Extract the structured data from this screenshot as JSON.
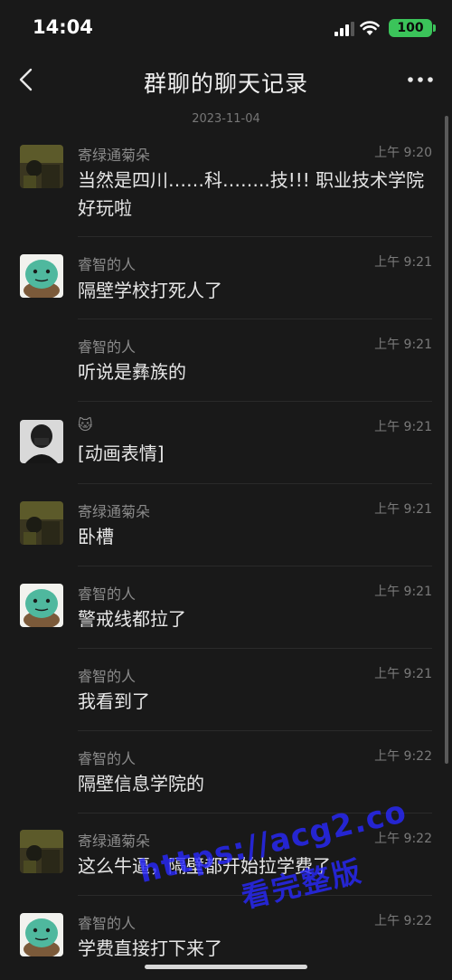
{
  "status_bar": {
    "time": "14:04",
    "battery": "100"
  },
  "nav": {
    "title": "群聊的聊天记录",
    "back_icon": "chevron-left-icon",
    "more_icon": "more-dots-icon"
  },
  "date_separator": "2023-11-04",
  "messages": [
    {
      "sender": "寄绿通菊朵",
      "time": "上午 9:20",
      "text": "当然是四川……科……..技!!! 职业技术学院好玩啦",
      "avatar": "avatar-dark-photo"
    },
    {
      "sender": "睿智的人",
      "time": "上午 9:21",
      "text": "隔壁学校打死人了",
      "avatar": "avatar-green-turtle"
    },
    {
      "sender": "睿智的人",
      "time": "上午 9:21",
      "text": "听说是彝族的",
      "avatar": ""
    },
    {
      "sender": "🐱",
      "time": "上午 9:21",
      "text": "[动画表情]",
      "avatar": "avatar-masked-person"
    },
    {
      "sender": "寄绿通菊朵",
      "time": "上午 9:21",
      "text": "卧槽",
      "avatar": "avatar-dark-photo"
    },
    {
      "sender": "睿智的人",
      "time": "上午 9:21",
      "text": "警戒线都拉了",
      "avatar": "avatar-green-turtle"
    },
    {
      "sender": "睿智的人",
      "time": "上午 9:21",
      "text": "我看到了",
      "avatar": ""
    },
    {
      "sender": "睿智的人",
      "time": "上午 9:22",
      "text": "隔壁信息学院的",
      "avatar": ""
    },
    {
      "sender": "寄绿通菊朵",
      "time": "上午 9:22",
      "text": "这么牛逼，隔壁都开始拉学费了",
      "avatar": "avatar-dark-photo"
    },
    {
      "sender": "睿智的人",
      "time": "上午 9:22",
      "text": "学费直接打下来了",
      "avatar": "avatar-green-turtle"
    }
  ],
  "watermark": {
    "url": "https://acg2.co",
    "subtitle": "看完整版"
  }
}
